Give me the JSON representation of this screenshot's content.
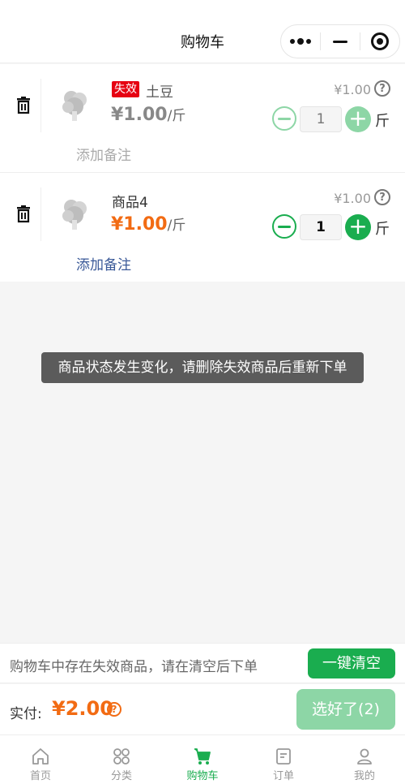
{
  "header": {
    "title": "购物车"
  },
  "items": [
    {
      "invalid_tag": "失效",
      "name": "土豆",
      "price": "¥1.00",
      "unit": "/斤",
      "original_price": "¥1.00",
      "quantity": "1",
      "unit_label": "斤",
      "remark": "添加备注",
      "icon": "broccoli-image"
    },
    {
      "name": "商品4",
      "price": "¥1.00",
      "unit": "/斤",
      "original_price": "¥1.00",
      "quantity": "1",
      "unit_label": "斤",
      "remark": "添加备注",
      "icon": "broccoli-image"
    }
  ],
  "toast": "商品状态发生变化，请删除失效商品后重新下单",
  "notice": {
    "text": "购物车中存在失效商品，请在清空后下单",
    "clear_label": "一键清空"
  },
  "total": {
    "label": "实付:",
    "amount": "¥2.00",
    "submit_label": "选好了(2)"
  },
  "tabs": [
    {
      "label": "首页",
      "icon": "home-icon"
    },
    {
      "label": "分类",
      "icon": "category-icon"
    },
    {
      "label": "购物车",
      "icon": "cart-icon",
      "active": true
    },
    {
      "label": "订单",
      "icon": "order-icon"
    },
    {
      "label": "我的",
      "icon": "user-icon"
    }
  ],
  "colors": {
    "accent": "#1aad4f",
    "price": "#f26b13",
    "invalid": "#e60012"
  }
}
